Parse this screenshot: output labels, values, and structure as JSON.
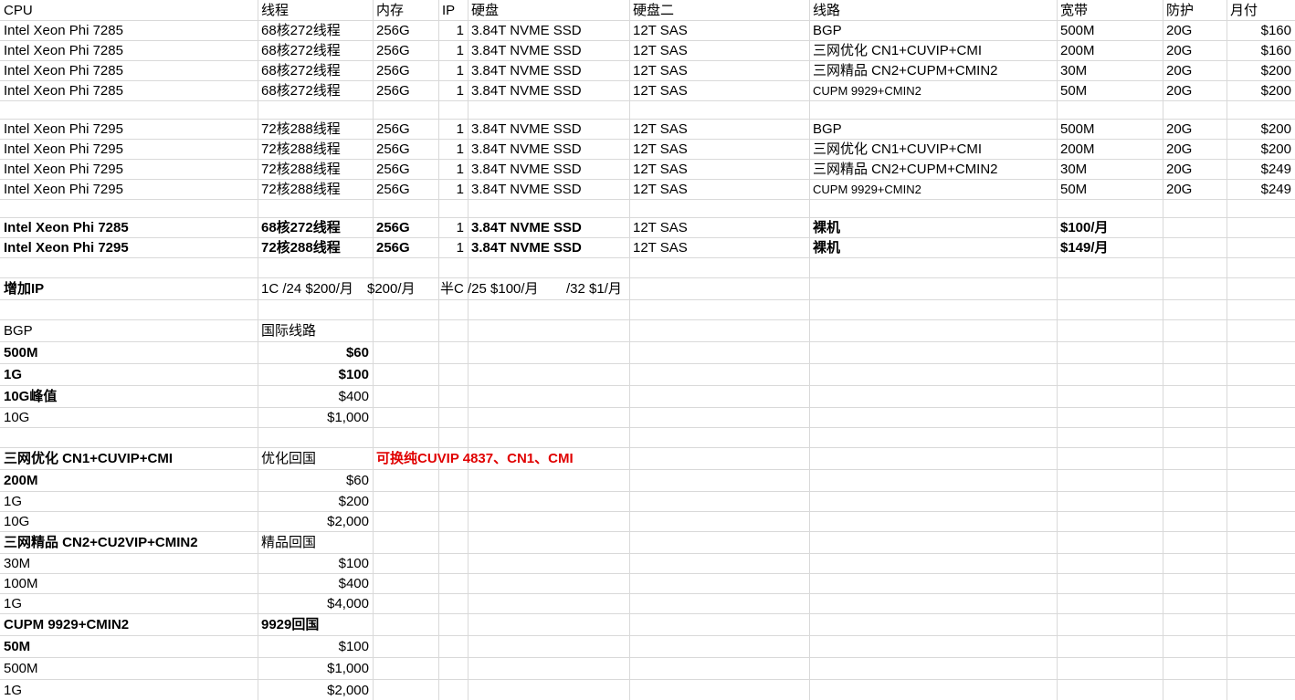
{
  "sheet": {
    "colors": {
      "grid": "#d9d9d9",
      "text": "#000000",
      "highlight": "#e00000"
    },
    "rows": [
      {
        "cells": [
          [
            "c0",
            "CPU"
          ],
          [
            "c1",
            "线程"
          ],
          [
            "c2",
            "内存"
          ],
          [
            "c3",
            "IP"
          ],
          [
            "c4",
            "硬盘"
          ],
          [
            "c5",
            "硬盘二"
          ],
          [
            "c6",
            "线路"
          ],
          [
            "c7",
            "宽带"
          ],
          [
            "c8",
            "防护"
          ],
          [
            "c9",
            "月付"
          ]
        ]
      },
      {
        "cells": [
          [
            "c0",
            "Intel Xeon Phi 7285"
          ],
          [
            "c1",
            "68核272线程"
          ],
          [
            "c2",
            "256G"
          ],
          [
            "c3r",
            "1"
          ],
          [
            "c4",
            "3.84T NVME SSD"
          ],
          [
            "c5",
            "12T SAS"
          ],
          [
            "c6",
            "BGP"
          ],
          [
            "c7",
            "500M"
          ],
          [
            "c8",
            "20G"
          ],
          [
            "c9r",
            "$160"
          ]
        ]
      },
      {
        "cells": [
          [
            "c0",
            "Intel Xeon Phi 7285"
          ],
          [
            "c1",
            "68核272线程"
          ],
          [
            "c2",
            "256G"
          ],
          [
            "c3r",
            "1"
          ],
          [
            "c4",
            "3.84T NVME SSD"
          ],
          [
            "c5",
            "12T SAS"
          ],
          [
            "c6",
            "三网优化 CN1+CUVIP+CMI"
          ],
          [
            "c7",
            "200M"
          ],
          [
            "c8",
            "20G"
          ],
          [
            "c9r",
            "$160"
          ]
        ]
      },
      {
        "cells": [
          [
            "c0",
            "Intel Xeon Phi 7285"
          ],
          [
            "c1",
            "68核272线程"
          ],
          [
            "c2",
            "256G"
          ],
          [
            "c3r",
            "1"
          ],
          [
            "c4",
            "3.84T NVME SSD"
          ],
          [
            "c5",
            "12T SAS"
          ],
          [
            "c6",
            "三网精品 CN2+CUPM+CMIN2"
          ],
          [
            "c7",
            "30M"
          ],
          [
            "c8",
            "20G"
          ],
          [
            "c9r",
            "$200"
          ]
        ]
      },
      {
        "cells": [
          [
            "c0",
            "Intel Xeon Phi 7285"
          ],
          [
            "c1",
            "68核272线程"
          ],
          [
            "c2",
            "256G"
          ],
          [
            "c3r",
            "1"
          ],
          [
            "c4",
            "3.84T NVME SSD"
          ],
          [
            "c5",
            "12T SAS"
          ],
          [
            "c6s",
            "CUPM 9929+CMIN2"
          ],
          [
            "c7",
            "50M"
          ],
          [
            "c8",
            "20G"
          ],
          [
            "c9r",
            "$200"
          ]
        ]
      },
      {
        "cells": []
      },
      {
        "cells": [
          [
            "c0",
            "Intel Xeon Phi 7295"
          ],
          [
            "c1",
            "72核288线程"
          ],
          [
            "c2",
            "256G"
          ],
          [
            "c3r",
            "1"
          ],
          [
            "c4",
            "3.84T NVME SSD"
          ],
          [
            "c5",
            "12T SAS"
          ],
          [
            "c6",
            "BGP"
          ],
          [
            "c7",
            "500M"
          ],
          [
            "c8",
            "20G"
          ],
          [
            "c9r",
            "$200"
          ]
        ]
      },
      {
        "cells": [
          [
            "c0",
            "Intel Xeon Phi 7295"
          ],
          [
            "c1",
            "72核288线程"
          ],
          [
            "c2",
            "256G"
          ],
          [
            "c3r",
            "1"
          ],
          [
            "c4",
            "3.84T NVME SSD"
          ],
          [
            "c5",
            "12T SAS"
          ],
          [
            "c6",
            "三网优化 CN1+CUVIP+CMI"
          ],
          [
            "c7",
            "200M"
          ],
          [
            "c8",
            "20G"
          ],
          [
            "c9r",
            "$200"
          ]
        ]
      },
      {
        "cells": [
          [
            "c0",
            "Intel Xeon Phi 7295"
          ],
          [
            "c1",
            "72核288线程"
          ],
          [
            "c2",
            "256G"
          ],
          [
            "c3r",
            "1"
          ],
          [
            "c4",
            "3.84T NVME SSD"
          ],
          [
            "c5",
            "12T SAS"
          ],
          [
            "c6",
            "三网精品 CN2+CUPM+CMIN2"
          ],
          [
            "c7",
            "30M"
          ],
          [
            "c8",
            "20G"
          ],
          [
            "c9r",
            "$249"
          ]
        ]
      },
      {
        "cells": [
          [
            "c0",
            "Intel Xeon Phi 7295"
          ],
          [
            "c1",
            "72核288线程"
          ],
          [
            "c2",
            "256G"
          ],
          [
            "c3r",
            "1"
          ],
          [
            "c4",
            "3.84T NVME SSD"
          ],
          [
            "c5",
            "12T SAS"
          ],
          [
            "c6s",
            "CUPM 9929+CMIN2"
          ],
          [
            "c7",
            "50M"
          ],
          [
            "c8",
            "20G"
          ],
          [
            "c9r",
            "$249"
          ]
        ]
      },
      {
        "cells": []
      },
      {
        "cells": [
          [
            "c0b",
            "Intel Xeon Phi 7285"
          ],
          [
            "c1b",
            "68核272线程"
          ],
          [
            "c2b",
            "256G"
          ],
          [
            "c3r",
            "1"
          ],
          [
            "c4b",
            "3.84T NVME SSD"
          ],
          [
            "c5",
            "12T SAS"
          ],
          [
            "c6b",
            "裸机"
          ],
          [
            "c7b",
            "$100/月"
          ]
        ]
      },
      {
        "cells": [
          [
            "c0b",
            "Intel Xeon Phi 7295"
          ],
          [
            "c1b",
            "72核288线程"
          ],
          [
            "c2b",
            "256G"
          ],
          [
            "c3r",
            "1"
          ],
          [
            "c4b",
            "3.84T NVME SSD"
          ],
          [
            "c5",
            "12T SAS"
          ],
          [
            "c6b",
            "裸机"
          ],
          [
            "c7b",
            "$149/月"
          ]
        ]
      },
      {
        "cells": []
      },
      {
        "cells": [
          [
            "c0b",
            "增加IP"
          ],
          [
            "ipA",
            "1C /24 $200/月"
          ],
          [
            "ipB",
            "$200/月"
          ],
          [
            "ipC",
            "半C /25 $100/月"
          ],
          [
            "ipD",
            "/32 $1/月"
          ]
        ]
      },
      {
        "cells": []
      },
      {
        "cells": [
          [
            "c0",
            "BGP"
          ],
          [
            "c1",
            "国际线路"
          ]
        ]
      },
      {
        "cells": [
          [
            "c0b",
            "500M"
          ],
          [
            "c1rb",
            "$60"
          ]
        ]
      },
      {
        "cells": [
          [
            "c0b",
            "1G"
          ],
          [
            "c1rb",
            "$100"
          ]
        ]
      },
      {
        "cells": [
          [
            "c0b",
            "10G峰值"
          ],
          [
            "c1r",
            "$400"
          ]
        ]
      },
      {
        "cells": [
          [
            "c0",
            "10G"
          ],
          [
            "c1r",
            "$1,000"
          ]
        ]
      },
      {
        "cells": []
      },
      {
        "cells": [
          [
            "c0b",
            "三网优化 CN1+CUVIP+CMI"
          ],
          [
            "c1",
            "优化回国"
          ],
          [
            "note",
            "可换纯CUVIP 4837、CN1、CMI"
          ]
        ]
      },
      {
        "cells": [
          [
            "c0b",
            "200M"
          ],
          [
            "c1r",
            "$60"
          ]
        ]
      },
      {
        "cells": [
          [
            "c0",
            "1G"
          ],
          [
            "c1r",
            "$200"
          ]
        ]
      },
      {
        "cells": [
          [
            "c0",
            "10G"
          ],
          [
            "c1r",
            "$2,000"
          ]
        ]
      },
      {
        "cells": [
          [
            "c0b",
            "三网精品 CN2+CU2VIP+CMIN2"
          ],
          [
            "c1",
            "精品回国"
          ]
        ]
      },
      {
        "cells": [
          [
            "c0",
            "30M"
          ],
          [
            "c1r",
            "$100"
          ]
        ]
      },
      {
        "cells": [
          [
            "c0",
            "100M"
          ],
          [
            "c1r",
            "$400"
          ]
        ]
      },
      {
        "cells": [
          [
            "c0",
            "1G"
          ],
          [
            "c1r",
            "$4,000"
          ]
        ]
      },
      {
        "cells": [
          [
            "c0b",
            "CUPM 9929+CMIN2"
          ],
          [
            "c1b",
            "9929回国"
          ]
        ]
      },
      {
        "cells": [
          [
            "c0b",
            "50M"
          ],
          [
            "c1r",
            "$100"
          ]
        ]
      },
      {
        "cells": [
          [
            "c0",
            "500M"
          ],
          [
            "c1r",
            "$1,000"
          ]
        ]
      },
      {
        "cells": [
          [
            "c0",
            "1G"
          ],
          [
            "c1r",
            "$2,000"
          ]
        ]
      }
    ]
  }
}
